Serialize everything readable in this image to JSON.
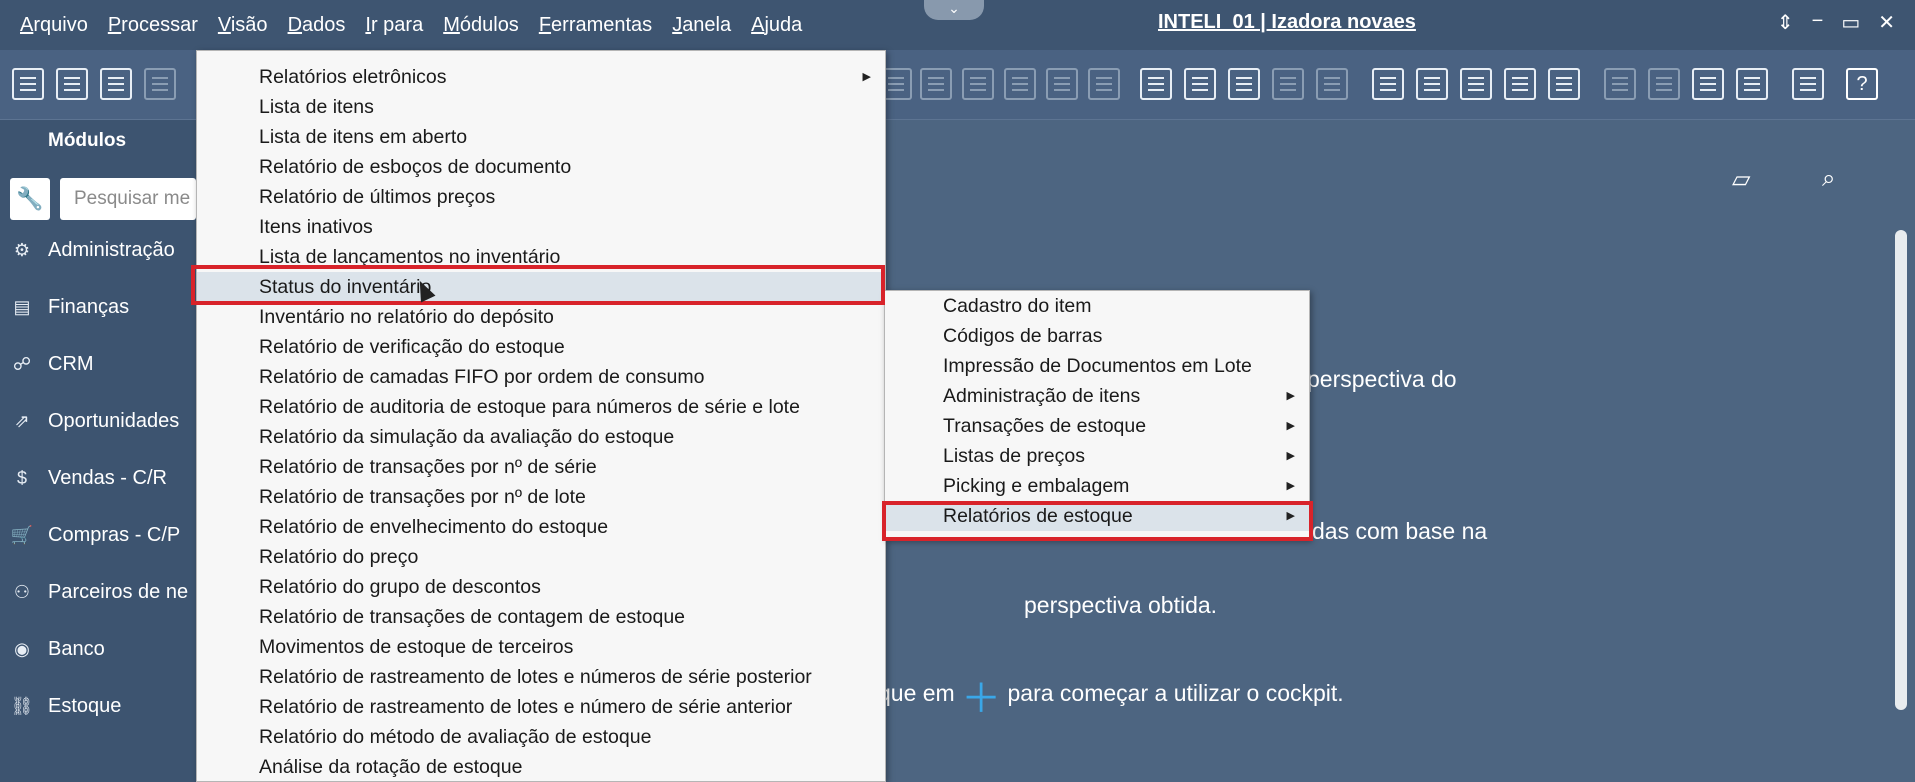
{
  "menubar": {
    "items": [
      "Arquivo",
      "Processar",
      "Visão",
      "Dados",
      "Ir para",
      "Módulos",
      "Ferramentas",
      "Janela",
      "Ajuda"
    ],
    "title": "INTELI_01 | Izadora novaes",
    "window_controls": [
      "⇕",
      "−",
      "▭",
      "✕"
    ]
  },
  "sidebar": {
    "title": "Módulos",
    "search_placeholder": "Pesquisar me",
    "items": [
      {
        "label": "Administração",
        "icon": "gear-icon"
      },
      {
        "label": "Finanças",
        "icon": "finance-icon"
      },
      {
        "label": "CRM",
        "icon": "crm-icon"
      },
      {
        "label": "Oportunidades",
        "icon": "opportunities-icon"
      },
      {
        "label": "Vendas - C/R",
        "icon": "sales-icon"
      },
      {
        "label": "Compras - C/P",
        "icon": "cart-icon"
      },
      {
        "label": "Parceiros de ne",
        "icon": "partners-icon"
      },
      {
        "label": "Banco",
        "icon": "bank-icon"
      },
      {
        "label": "Estoque",
        "icon": "inventory-icon"
      }
    ]
  },
  "main": {
    "text_line1": "perspectiva do",
    "text_line2": "das com base na",
    "text_line3": "perspectiva obtida.",
    "text_line4_left": "que em",
    "text_line4_right": "para começar a utilizar o cockpit."
  },
  "reports_menu": {
    "items": [
      {
        "label": "Relatórios eletrônicos",
        "has_submenu": true
      },
      {
        "label": "Lista de itens"
      },
      {
        "label": "Lista de itens em aberto"
      },
      {
        "label": "Relatório de esboços de documento"
      },
      {
        "label": "Relatório de últimos preços"
      },
      {
        "label": "Itens inativos"
      },
      {
        "label": "Lista de lançamentos no inventário"
      },
      {
        "label": "Status do inventário",
        "highlighted": true
      },
      {
        "label": "Inventário no relatório do depósito"
      },
      {
        "label": "Relatório de verificação do estoque"
      },
      {
        "label": "Relatório de camadas FIFO por ordem de consumo"
      },
      {
        "label": "Relatório de auditoria de estoque para números de série e lote"
      },
      {
        "label": "Relatório da simulação da avaliação do estoque"
      },
      {
        "label": "Relatório de transações por nº de série"
      },
      {
        "label": "Relatório de transações por nº de lote"
      },
      {
        "label": "Relatório de envelhecimento do estoque"
      },
      {
        "label": "Relatório do preço"
      },
      {
        "label": "Relatório do grupo de descontos"
      },
      {
        "label": "Relatório de transações de contagem de estoque"
      },
      {
        "label": "Movimentos de estoque de terceiros"
      },
      {
        "label": "Relatório de rastreamento de lotes e números de série posterior"
      },
      {
        "label": "Relatório de rastreamento de lotes e número de série anterior"
      },
      {
        "label": "Relatório do método de avaliação de estoque"
      },
      {
        "label": "Análise da rotação de estoque"
      }
    ]
  },
  "inventory_menu": {
    "items": [
      {
        "label": "Cadastro do item"
      },
      {
        "label": "Códigos de barras"
      },
      {
        "label": "Impressão de Documentos em Lote"
      },
      {
        "label": "Administração de itens",
        "has_submenu": true
      },
      {
        "label": "Transações de estoque",
        "has_submenu": true
      },
      {
        "label": "Listas de preços",
        "has_submenu": true
      },
      {
        "label": "Picking e embalagem",
        "has_submenu": true
      },
      {
        "label": "Relatórios de estoque",
        "has_submenu": true,
        "highlighted": true
      }
    ]
  },
  "colors": {
    "highlight_border": "#d8232a",
    "background": "#4d6581",
    "menubar": "#3e5571",
    "accent_plus": "#3aa7e8"
  }
}
